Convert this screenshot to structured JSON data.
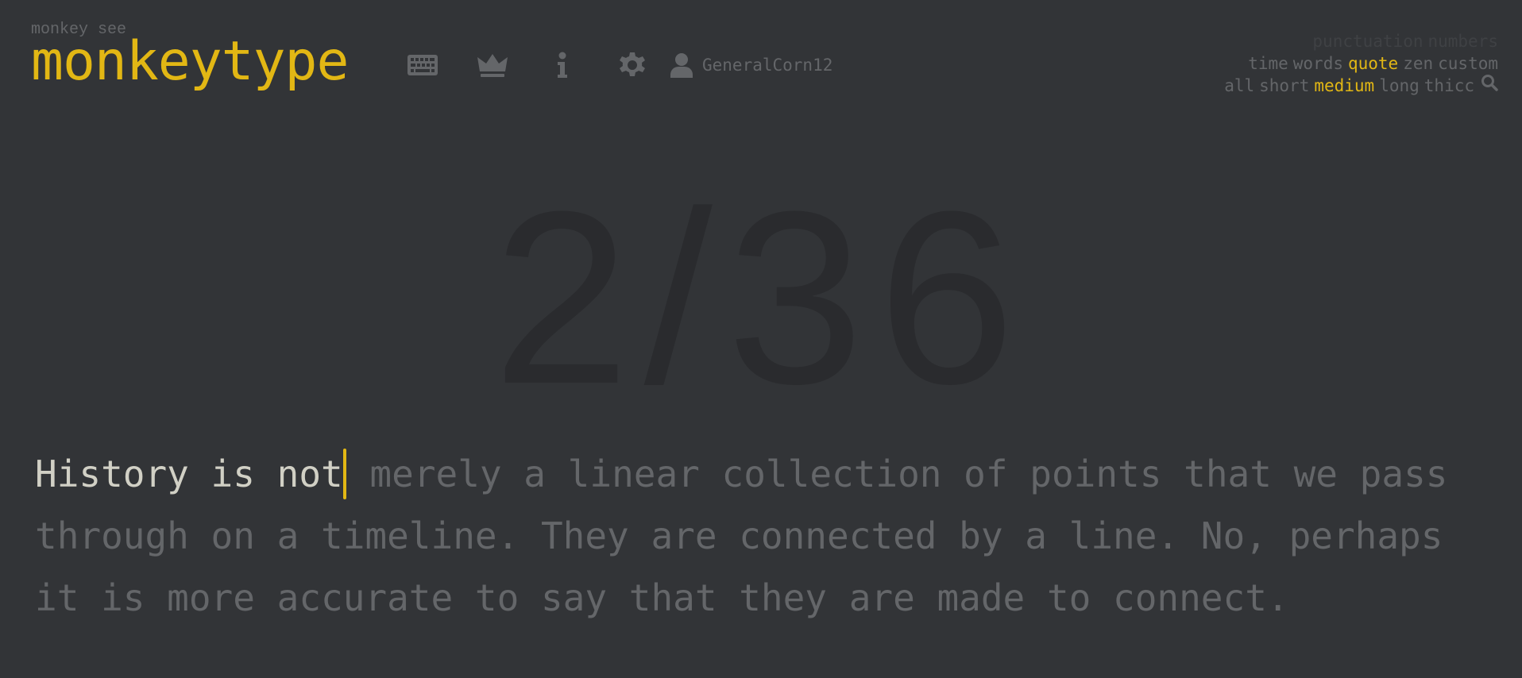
{
  "brand": {
    "subtitle": "monkey see",
    "title": "monkeytype"
  },
  "nav": {
    "icons": [
      "keyboard-icon",
      "crown-icon",
      "info-icon",
      "gear-icon",
      "user-icon"
    ],
    "username": "GeneralCorn12"
  },
  "config": {
    "row1": [
      "punctuation",
      "numbers"
    ],
    "row2": [
      "time",
      "words",
      "quote",
      "zen",
      "custom"
    ],
    "row3": [
      "all",
      "short",
      "medium",
      "long",
      "thicc"
    ],
    "active_mode": "quote",
    "active_length": "medium",
    "search_icon": "search-icon"
  },
  "test": {
    "progress": "2/36",
    "typed": "History is not",
    "remaining": " merely a linear collection of points that we pass through on a timeline. They are connected by a line. No, perhaps it is more accurate to say that they are made to connect."
  },
  "colors": {
    "background": "#323437",
    "accent": "#e2b714",
    "sub": "#646669",
    "text": "#d1d0c5"
  }
}
